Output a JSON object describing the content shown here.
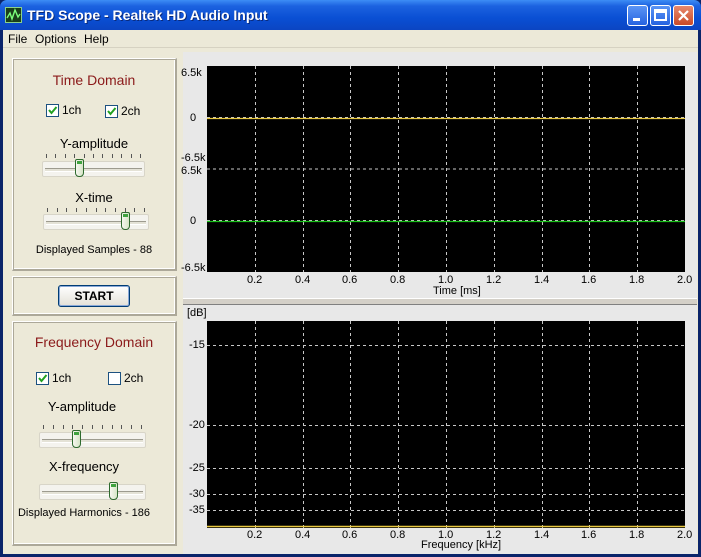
{
  "window": {
    "title": "TFD Scope - Realtek HD Audio Input"
  },
  "menu": [
    "File",
    "Options",
    "Help"
  ],
  "time_panel": {
    "title": "Time Domain",
    "ch1_label": "1ch",
    "ch1_checked": true,
    "ch2_label": "2ch",
    "ch2_checked": true,
    "y_label": "Y-amplitude",
    "y_level": 0.35,
    "x_label": "X-time",
    "x_level": 0.83,
    "displayed": "Displayed Samples - 88"
  },
  "start_label": "START",
  "freq_panel": {
    "title": "Frequency Domain",
    "ch1_label": "1ch",
    "ch1_checked": true,
    "ch2_label": "2ch",
    "ch2_checked": false,
    "y_label": "Y-amplitude",
    "y_level": 0.33,
    "x_label": "X-frequency",
    "x_level": 0.74,
    "displayed": "Displayed Harmonics - 186"
  },
  "time_scope": {
    "xlabel": "Time [ms]",
    "x_ticks": [
      "0.2",
      "0.4",
      "0.6",
      "0.8",
      "1.0",
      "1.2",
      "1.4",
      "1.6",
      "1.8",
      "2.0"
    ],
    "ch1_labels": [
      "6.5k",
      "0",
      "-6.5k"
    ],
    "ch2_labels": [
      "6.5k",
      "0",
      "-6.5k"
    ],
    "ch1_color": "#e8c840",
    "ch2_color": "#18c018"
  },
  "freq_scope": {
    "ylabel": "[dB]",
    "xlabel": "Frequency [kHz]",
    "x_ticks": [
      "0.2",
      "0.4",
      "0.6",
      "0.8",
      "1.0",
      "1.2",
      "1.4",
      "1.6",
      "1.8",
      "2.0"
    ],
    "y_ticks": [
      "-15",
      "-20",
      "-25",
      "-30",
      "-35"
    ],
    "trace_color": "#e8c840"
  },
  "colors": {
    "titlebar": "#0a4fd4",
    "panel_title": "#8b1a1a",
    "plot_bg": "#000000",
    "grid": "#c8c8c8"
  }
}
